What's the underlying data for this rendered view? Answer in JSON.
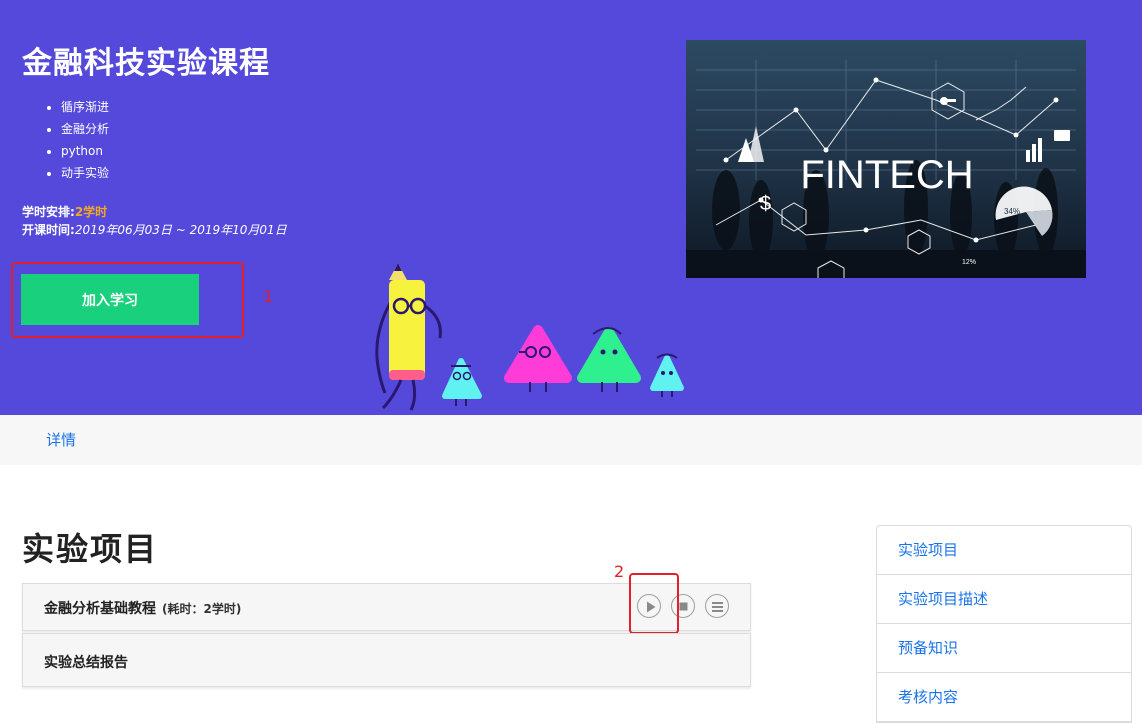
{
  "course": {
    "title": "金融科技实验课程",
    "tags": [
      "循序渐进",
      "金融分析",
      "python",
      "动手实验"
    ],
    "hours_label": "学时安排:",
    "hours_value": "2学时",
    "dates_label": "开课时间:",
    "dates_value": "2019年06月03日 ~ 2019年10月01日",
    "join_label": "加入学习",
    "banner_text": "FINTECH",
    "banner_pct_a": "34%",
    "banner_pct_b": "12%"
  },
  "annotations": {
    "first": "1",
    "second": "2"
  },
  "tabs": {
    "detail": "详情"
  },
  "projects": {
    "title": "实验项目",
    "items": [
      {
        "name": "金融分析基础教程",
        "duration": "(耗时：2学时)"
      },
      {
        "name": "实验总结报告"
      }
    ]
  },
  "side_nav": [
    "实验项目",
    "实验项目描述",
    "预备知识",
    "考核内容"
  ],
  "colors": {
    "hero": "#5549dc",
    "join_button": "#19d07c",
    "accent": "#f5a623",
    "link": "#1a73e8",
    "annotation": "#e3202a"
  },
  "icons": [
    "play-icon",
    "stop-icon",
    "menu-icon"
  ]
}
